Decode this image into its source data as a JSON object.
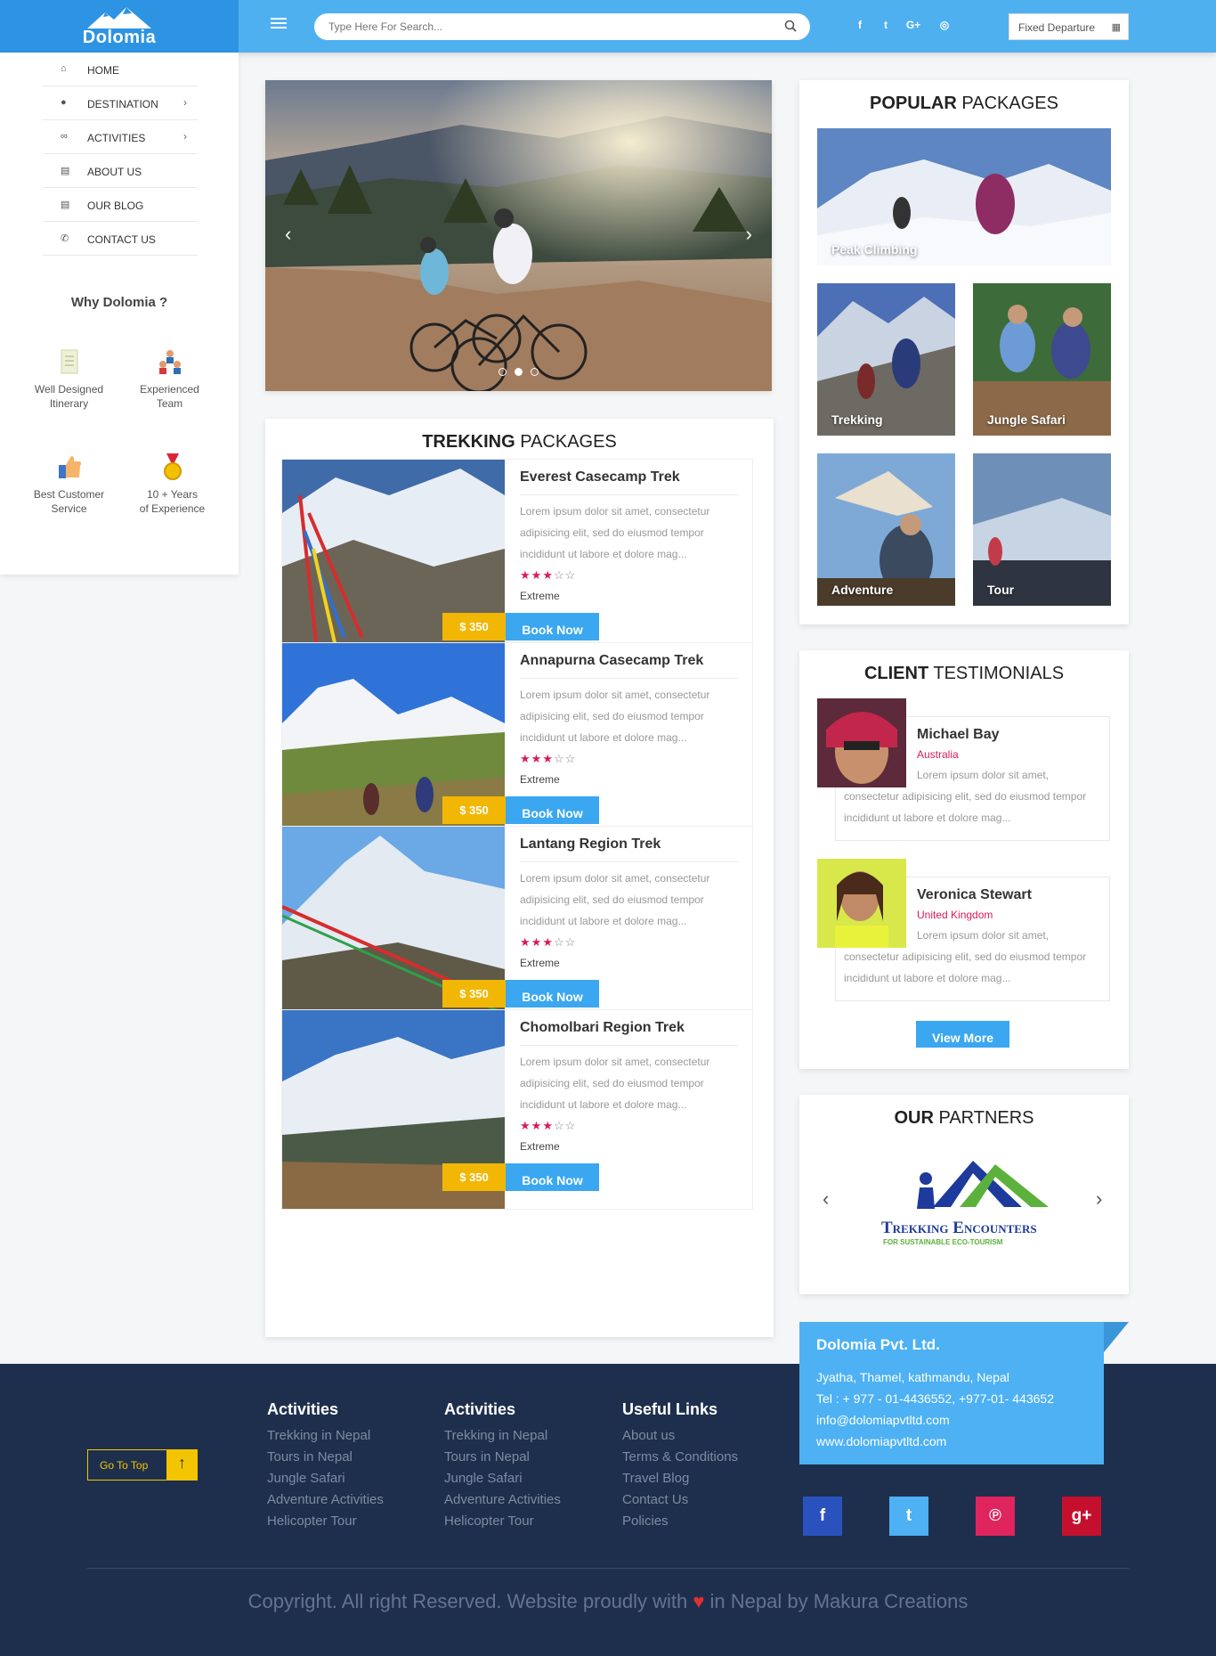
{
  "header": {
    "brand": "Dolomia",
    "search_placeholder": "Type Here For Search...",
    "social_icons": [
      "facebook-icon",
      "twitter-icon",
      "google-plus-icon",
      "instagram-icon"
    ],
    "social_glyphs": [
      "f",
      "t",
      "G+",
      "◎"
    ],
    "departure_select": "Fixed Departure"
  },
  "sidebar": {
    "items": [
      {
        "label": "HOME",
        "icon": "home-icon",
        "has_submenu": false
      },
      {
        "label": "DESTINATION",
        "icon": "map-pin-icon",
        "has_submenu": true
      },
      {
        "label": "ACTIVITIES",
        "icon": "bicycle-icon",
        "has_submenu": true
      },
      {
        "label": "ABOUT US",
        "icon": "clipboard-icon",
        "has_submenu": false
      },
      {
        "label": "OUR BLOG",
        "icon": "clipboard-icon",
        "has_submenu": false
      },
      {
        "label": "CONTACT US",
        "icon": "phone-icon",
        "has_submenu": false
      }
    ],
    "why_title": "Why Dolomia ?",
    "features": [
      {
        "line1": "Well Designed",
        "line2": "Itinerary",
        "icon": "document-icon"
      },
      {
        "line1": "Experienced",
        "line2": "Team",
        "icon": "team-icon"
      },
      {
        "line1": "Best Customer",
        "line2": "Service",
        "icon": "thumbs-up-icon"
      },
      {
        "line1": "10 + Years",
        "line2": "of Experience",
        "icon": "medal-icon"
      }
    ]
  },
  "hero": {
    "active_slide": 2,
    "slide_count": 3
  },
  "trekking": {
    "title_bold": "TREKKING",
    "title_rest": " PACKAGES",
    "packages": [
      {
        "name": "Everest Casecamp Trek",
        "desc": "Lorem ipsum dolor sit amet, consectetur adipisicing elit, sed do eiusmod tempor incididunt ut labore et dolore mag...",
        "rating": 3,
        "max_rating": 5,
        "level": "Extreme",
        "price": "$ 350",
        "book_label": "Book Now"
      },
      {
        "name": "Annapurna Casecamp Trek",
        "desc": "Lorem ipsum dolor sit amet, consectetur adipisicing elit, sed do eiusmod tempor incididunt ut labore et dolore mag...",
        "rating": 3,
        "max_rating": 5,
        "level": "Extreme",
        "price": "$ 350",
        "book_label": "Book Now"
      },
      {
        "name": "Lantang Region Trek",
        "desc": "Lorem ipsum dolor sit amet, consectetur adipisicing elit, sed do eiusmod tempor incididunt ut labore et dolore mag...",
        "rating": 3,
        "max_rating": 5,
        "level": "Extreme",
        "price": "$ 350",
        "book_label": "Book Now"
      },
      {
        "name": "Chomolbari Region Trek",
        "desc": "Lorem ipsum dolor sit amet, consectetur adipisicing elit, sed do eiusmod tempor incididunt ut labore et dolore mag...",
        "rating": 3,
        "max_rating": 5,
        "level": "Extreme",
        "price": "$ 350",
        "book_label": "Book Now"
      }
    ]
  },
  "popular": {
    "title_bold": "POPULAR",
    "title_rest": " PACKAGES",
    "tiles": [
      "Peak Climbing",
      "Trekking",
      "Jungle Safari",
      "Adventure",
      "Tour"
    ]
  },
  "testimonials": {
    "title_bold": "CLIENT",
    "title_rest": " TESTIMONIALS",
    "items": [
      {
        "name": "Michael Bay",
        "country": "Australia",
        "text": "Lorem ipsum dolor sit amet, consectetur adipisicing elit, sed do eiusmod tempor incididunt ut labore et dolore mag..."
      },
      {
        "name": "Veronica Stewart",
        "country": "United Kingdom",
        "text": "Lorem ipsum dolor sit amet, consectetur adipisicing elit, sed do eiusmod tempor incididunt ut labore et dolore mag..."
      }
    ],
    "view_more": "View More"
  },
  "partners": {
    "title_bold": "OUR",
    "title_rest": " PARTNERS",
    "logo_line1": "Trekking Encounters",
    "logo_line2": "FOR SUSTAINABLE ECO-TOURISM"
  },
  "footer": {
    "go_top": "Go To Top",
    "columns": [
      {
        "title": "Activities",
        "links": [
          "Trekking in Nepal",
          "Tours in Nepal",
          "Jungle Safari",
          "Adventure Activities",
          "Helicopter Tour"
        ]
      },
      {
        "title": "Activities",
        "links": [
          "Trekking in Nepal",
          "Tours in Nepal",
          "Jungle Safari",
          "Adventure Activities",
          "Helicopter Tour"
        ]
      },
      {
        "title": "Useful Links",
        "links": [
          "About us",
          "Terms & Conditions",
          "Travel Blog",
          "Contact Us",
          "Policies"
        ]
      }
    ],
    "company": {
      "name": "Dolomia Pvt. Ltd.",
      "address": "Jyatha, Thamel, kathmandu, Nepal",
      "tel": "Tel : + 977 - 01-4436552, +977-01- 443652",
      "email": "info@dolomiapvtltd.com",
      "web": "www.dolomiapvtltd.com"
    },
    "social": [
      {
        "icon": "facebook-icon",
        "glyph": "f",
        "color": "#2a52be"
      },
      {
        "icon": "twitter-icon",
        "glyph": "t",
        "color": "#4db1f4"
      },
      {
        "icon": "pinterest-icon",
        "glyph": "℗",
        "color": "#e0245e"
      },
      {
        "icon": "google-plus-icon",
        "glyph": "g+",
        "color": "#c4102e"
      }
    ],
    "copyright_before": "Copyright. All right Reserved. Website proudly with ",
    "copyright_after": " in Nepal by Makura Creations"
  }
}
